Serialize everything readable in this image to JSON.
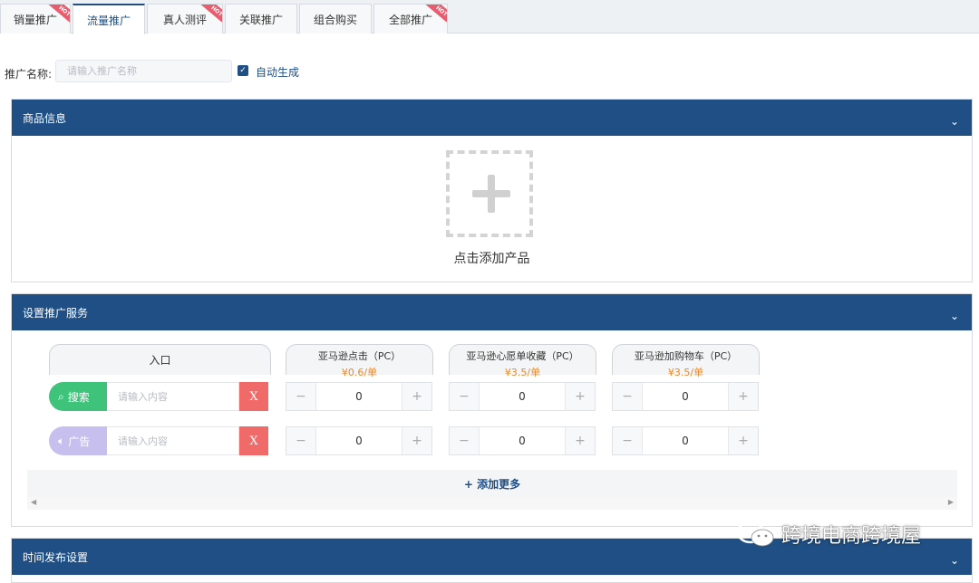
{
  "tabs": [
    {
      "label": "销量推广",
      "hot": "HOT"
    },
    {
      "label": "流量推广",
      "active": true
    },
    {
      "label": "真人测评",
      "hot": "HOT"
    },
    {
      "label": "关联推广"
    },
    {
      "label": "组合购买"
    },
    {
      "label": "全部推广",
      "hot": "HOT"
    }
  ],
  "name_row": {
    "label": "推广名称:",
    "placeholder": "请输入推广名称",
    "auto_label": "自动生成",
    "auto_checked": true
  },
  "product_section": {
    "title": "商品信息",
    "add_label": "点击添加产品"
  },
  "service_section": {
    "title": "设置推广服务",
    "entry_header": "入口",
    "columns": [
      {
        "title": "亚马逊点击（PC）",
        "price": "¥0.6/单"
      },
      {
        "title": "亚马逊心愿单收藏（PC）",
        "price": "¥3.5/单"
      },
      {
        "title": "亚马逊加购物车（PC）",
        "price": "¥3.5/单"
      }
    ],
    "rows": [
      {
        "type": "搜索",
        "icon": "search-icon",
        "placeholder": "请输入内容",
        "remove": "X",
        "values": [
          "0",
          "0",
          "0"
        ]
      },
      {
        "type": "广告",
        "icon": "speaker-icon",
        "placeholder": "请输入内容",
        "remove": "X",
        "values": [
          "0",
          "0",
          "0"
        ]
      }
    ],
    "stepper_minus": "−",
    "stepper_plus": "+",
    "add_more": "+ 添加更多"
  },
  "time_section": {
    "title": "时间发布设置"
  },
  "watermark": "跨境电商跨境屋",
  "colors": {
    "primary": "#1f4f84",
    "hot": "#e85d6e",
    "green": "#3fc27a",
    "purple": "#c7c0ef",
    "remove": "#f06a6a",
    "price": "#e8892c"
  }
}
